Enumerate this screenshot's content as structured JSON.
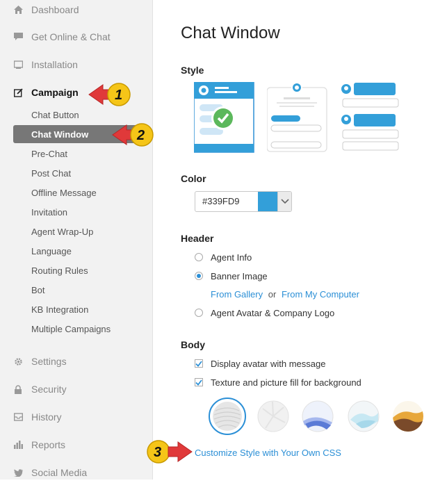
{
  "sidebar": {
    "top_items": [
      {
        "label": "Dashboard",
        "icon": "home-icon"
      },
      {
        "label": "Get Online & Chat",
        "icon": "chat-bubble-icon"
      },
      {
        "label": "Installation",
        "icon": "monitor-icon"
      },
      {
        "label": "Campaign",
        "icon": "edit-icon",
        "active": true
      }
    ],
    "sub_items": [
      {
        "label": "Chat Button"
      },
      {
        "label": "Chat Window",
        "active": true
      },
      {
        "label": "Pre-Chat"
      },
      {
        "label": "Post Chat"
      },
      {
        "label": "Offline Message"
      },
      {
        "label": "Invitation"
      },
      {
        "label": "Agent Wrap-Up"
      },
      {
        "label": "Language"
      },
      {
        "label": "Routing Rules"
      },
      {
        "label": "Bot"
      },
      {
        "label": "KB Integration"
      },
      {
        "label": "Multiple Campaigns"
      }
    ],
    "bottom_items": [
      {
        "label": "Settings",
        "icon": "gear-icon"
      },
      {
        "label": "Security",
        "icon": "lock-icon"
      },
      {
        "label": "History",
        "icon": "inbox-icon"
      },
      {
        "label": "Reports",
        "icon": "bar-chart-icon"
      },
      {
        "label": "Social Media",
        "icon": "bird-icon"
      }
    ]
  },
  "main": {
    "title": "Chat Window",
    "style_label": "Style",
    "color_label": "Color",
    "color_value": "#339FD9",
    "header_label": "Header",
    "header_options": [
      "Agent Info",
      "Banner Image",
      "Agent Avatar & Company Logo"
    ],
    "header_selected": "Banner Image",
    "from_gallery": "From Gallery",
    "or_text": "or",
    "from_computer": "From My Computer",
    "body_label": "Body",
    "body_options": [
      "Display avatar with message",
      "Texture and picture fill for background"
    ],
    "customize_link": "Customize Style with Your Own CSS"
  },
  "callouts": [
    "1",
    "2",
    "3"
  ],
  "colors": {
    "accent": "#339FD9",
    "link": "#2b8fd6",
    "callout_red": "#e0393a",
    "callout_yellow": "#f5c518"
  }
}
